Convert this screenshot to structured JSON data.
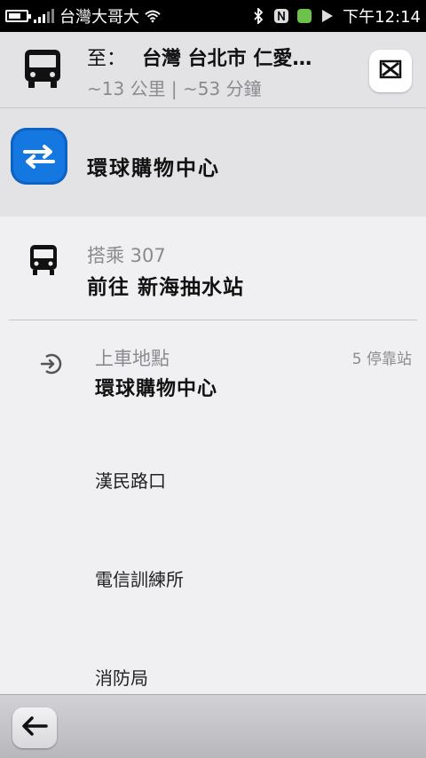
{
  "status_bar": {
    "carrier": "台灣大哥大",
    "time": "下午12:14"
  },
  "header": {
    "dest_label": "至：",
    "dest_text": "台灣 台北市 仁愛…",
    "subinfo": "~13 公里 | ~53 分鐘"
  },
  "swap": {
    "place": "環球購物中心"
  },
  "ride": {
    "label": "搭乘 307",
    "direction": "前往 新海抽水站"
  },
  "boarding": {
    "label": "上車地點",
    "stop_count": "5 停靠站",
    "stop": "環球購物中心"
  },
  "stops": [
    "漢民路口",
    "電信訓練所",
    "消防局"
  ],
  "colors": {
    "accent": "#1577e0",
    "header_bg": "#e3e3e6",
    "body_bg": "#f0f0f2"
  }
}
